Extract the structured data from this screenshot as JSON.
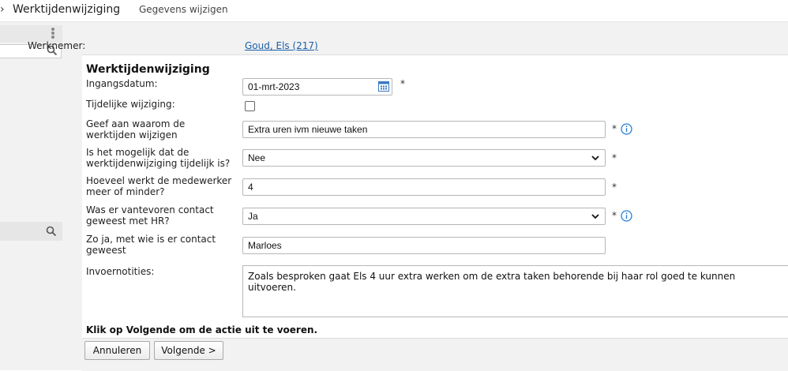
{
  "header": {
    "chevron": "›",
    "title": "Werktijdenwijziging",
    "subtitle": "Gegevens wijzigen"
  },
  "employee": {
    "label": "Werknemer:",
    "name": "Goud, Els (217)"
  },
  "form": {
    "heading": "Werktijdenwijziging",
    "required_mark": "*",
    "start_date": {
      "label": "Ingangsdatum:",
      "value": "01-mrt-2023"
    },
    "temporary": {
      "label": "Tijdelijke wijziging:",
      "checked": false
    },
    "reason": {
      "label": "Geef aan waarom de werktijden wijzigen",
      "value": "Extra uren ivm nieuwe taken"
    },
    "maybe_temporary": {
      "label": "Is het mogelijk dat de werktijdenwijziging tijdelijk is?",
      "value": "Nee"
    },
    "hours": {
      "label": "Hoeveel werkt de medewerker meer of minder?",
      "value": "4"
    },
    "hr_contact": {
      "label": "Was er vantevoren contact geweest met HR?",
      "value": "Ja"
    },
    "contact_person": {
      "label": "Zo ja, met wie is er contact geweest",
      "value": "Marloes"
    },
    "notes": {
      "label": "Invoernotities:",
      "value": "Zoals besproken gaat Els 4 uur extra werken om de extra taken behorende bij haar rol goed te kunnen uitvoeren."
    },
    "instruction": "Klik op Volgende om de actie uit te voeren."
  },
  "buttons": {
    "cancel": "Annuleren",
    "next": "Volgende >"
  },
  "colors": {
    "link": "#1a5fa8",
    "info": "#2a7fd0",
    "background": "#f2f2f2"
  },
  "icons": [
    "kebab-icon",
    "search-icon",
    "calendar-icon",
    "info-icon",
    "chevron-down-icon"
  ]
}
